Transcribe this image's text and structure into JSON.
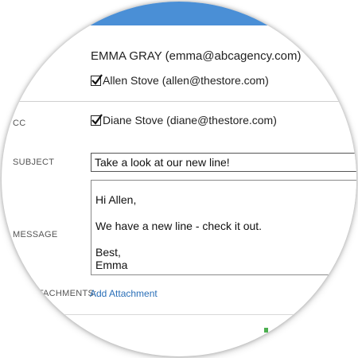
{
  "header": {
    "from": "EMMA GRAY (emma@abcagency.com)"
  },
  "recipients": {
    "to": {
      "label": "Allen Stove (allen@thestore.com)",
      "checked": true
    },
    "cc_label": "CC",
    "cc": {
      "label": "Diane Stove (diane@thestore.com)",
      "checked": true
    }
  },
  "subject": {
    "label": "SUBJECT",
    "value": "Take a look at our new line!"
  },
  "message": {
    "label": "MESSAGE",
    "greeting": "Hi Allen,",
    "body": "We have a new line - check it out.",
    "closing": "Best,",
    "signature": "Emma"
  },
  "attachments": {
    "label": "ATTACHMENTS:",
    "add_label": "Add Attachment"
  },
  "colors": {
    "accent": "#4a8fd6",
    "link": "#2a6fb8"
  }
}
